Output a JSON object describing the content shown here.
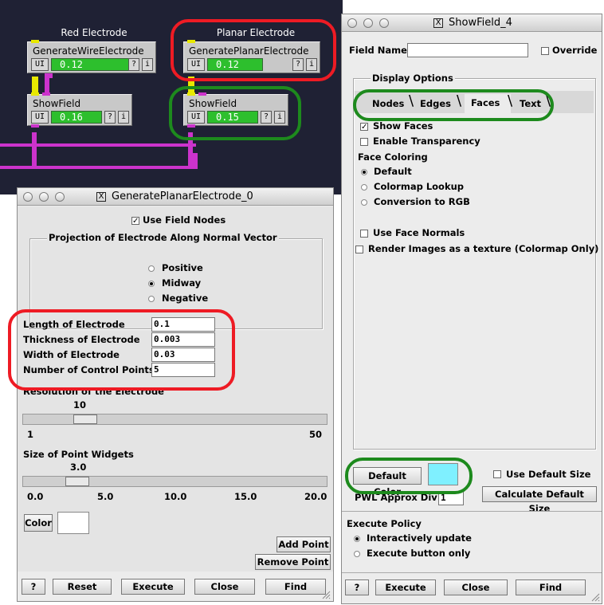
{
  "network": {
    "groups": [
      {
        "title": "Red Electrode"
      },
      {
        "title": "Planar Electrode"
      }
    ],
    "modules": [
      {
        "name": "GenerateWireElectrode",
        "ui": "UI",
        "time": "0.12",
        "help": "?",
        "info": "i"
      },
      {
        "name": "GeneratePlanarElectrode",
        "ui": "UI",
        "time": "0.12",
        "help": "?",
        "info": "i"
      },
      {
        "name": "ShowField",
        "ui": "UI",
        "time": "0.16",
        "help": "?",
        "info": "i"
      },
      {
        "name": "ShowField",
        "ui": "UI",
        "time": "0.15",
        "help": "?",
        "info": "i"
      }
    ]
  },
  "planar_window": {
    "title": "GeneratePlanarElectrode_0",
    "use_field_nodes": "Use Field Nodes",
    "projection_label": "Projection of Electrode Along Normal Vector",
    "projection_options": [
      "Positive",
      "Midway",
      "Negative"
    ],
    "selected_projection": "Midway",
    "fields": [
      {
        "label": "Length of Electrode",
        "value": "0.1"
      },
      {
        "label": "Thickness of Electrode",
        "value": "0.003"
      },
      {
        "label": "Width of Electrode",
        "value": "0.03"
      },
      {
        "label": "Number of Control Points",
        "value": "5"
      }
    ],
    "resolution": {
      "label": "Resolution of the Electrode",
      "value": "10",
      "min": "1",
      "max": "50",
      "fraction": 0.18
    },
    "point_size": {
      "label": "Size of Point Widgets",
      "value": "3.0",
      "ticks": [
        "0.0",
        "5.0",
        "10.0",
        "15.0",
        "20.0"
      ],
      "fraction": 0.15
    },
    "color_label": "Color",
    "add_point": "Add Point",
    "remove_point": "Remove Point",
    "buttons": {
      "help": "?",
      "reset": "Reset",
      "execute": "Execute",
      "close": "Close",
      "find": "Find"
    }
  },
  "showfield_window": {
    "title": "ShowField_4",
    "field_name_label": "Field Name",
    "field_name_value": "",
    "override": "Override",
    "display_options": "Display Options",
    "tabs": [
      "Nodes",
      "Edges",
      "Faces",
      "Text"
    ],
    "active_tab": "Faces",
    "show_faces": "Show Faces",
    "enable_transparency": "Enable Transparency",
    "face_coloring": "Face Coloring",
    "coloring_options": [
      "Default",
      "Colormap Lookup",
      "Conversion to RGB"
    ],
    "selected_coloring": "Default",
    "use_face_normals": "Use Face Normals",
    "render_images": "Render Images as a texture (Colormap Only)",
    "default_color_label": "Default Color",
    "default_color": "#7ff0ff",
    "use_default_size": "Use Default Size",
    "pwl_label": "PWL Approx Div:",
    "pwl_value": "1",
    "calc_default_size": "Calculate Default Size",
    "execute_policy": "Execute Policy",
    "policy_options": [
      "Interactively update",
      "Execute button only"
    ],
    "selected_policy": "Interactively update",
    "buttons": {
      "help": "?",
      "execute": "Execute",
      "close": "Close",
      "find": "Find"
    }
  },
  "colors": {
    "highlight_red": "#ee1b24",
    "highlight_green": "#1d8a1d",
    "wire": "#cc33cc",
    "progress": "#2dbf2d",
    "canvas": "#1f2134"
  }
}
